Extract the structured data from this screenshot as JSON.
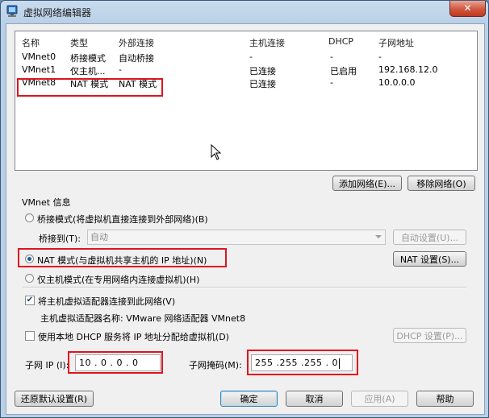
{
  "window": {
    "title": "虚拟网络编辑器",
    "close_label": "✕"
  },
  "table": {
    "columns": [
      "名称",
      "类型",
      "外部连接",
      "主机连接",
      "DHCP",
      "子网地址"
    ],
    "rows": [
      {
        "name": "VMnet0",
        "type": "桥接模式",
        "external": "自动桥接",
        "host": "-",
        "dhcp": "-",
        "subnet": "-"
      },
      {
        "name": "VMnet1",
        "type": "仅主机...",
        "external": "-",
        "host": "已连接",
        "dhcp": "已启用",
        "subnet": "192.168.12.0"
      },
      {
        "name": "VMnet8",
        "type": "NAT 模式",
        "external": "NAT 模式",
        "host": "已连接",
        "dhcp": "-",
        "subnet": "10.0.0.0"
      }
    ]
  },
  "list_buttons": {
    "add_network": "添加网络(E)...",
    "remove_network": "移除网络(O)"
  },
  "vmnet_info": {
    "header": "VMnet 信息",
    "bridged_label": "桥接模式(将虚拟机直接连接到外部网络)(B)",
    "bridged_to_label": "桥接到(T):",
    "bridged_to_value": "自动",
    "auto_settings": "自动设置(U)...",
    "nat_label": "NAT 模式(与虚拟机共享主机的 IP 地址)(N)",
    "nat_settings": "NAT 设置(S)...",
    "hostonly_label": "仅主机模式(在专用网络内连接虚拟机)(H)",
    "connect_adapter_label": "将主机虚拟适配器连接到此网络(V)",
    "adapter_name_label": "主机虚拟适配器名称: VMware 网络适配器 VMnet8",
    "dhcp_label": "使用本地 DHCP 服务将 IP 地址分配给虚拟机(D)",
    "dhcp_settings": "DHCP 设置(P)...",
    "subnet_ip_label": "子网 IP (I):",
    "subnet_ip_value": "10 . 0 . 0 . 0",
    "subnet_mask_label": "子网掩码(M):",
    "subnet_mask_value": "255 .255 .255 . 0"
  },
  "states": {
    "selected_mode": "nat",
    "connect_adapter_checked": true,
    "dhcp_checked": false
  },
  "footer": {
    "restore_defaults": "还原默认设置(R)",
    "ok": "确定",
    "cancel": "取消",
    "apply": "应用(A)",
    "help": "帮助"
  },
  "colors": {
    "highlight_red": "#e0141e",
    "radio_selected": "#1d5f9a"
  }
}
